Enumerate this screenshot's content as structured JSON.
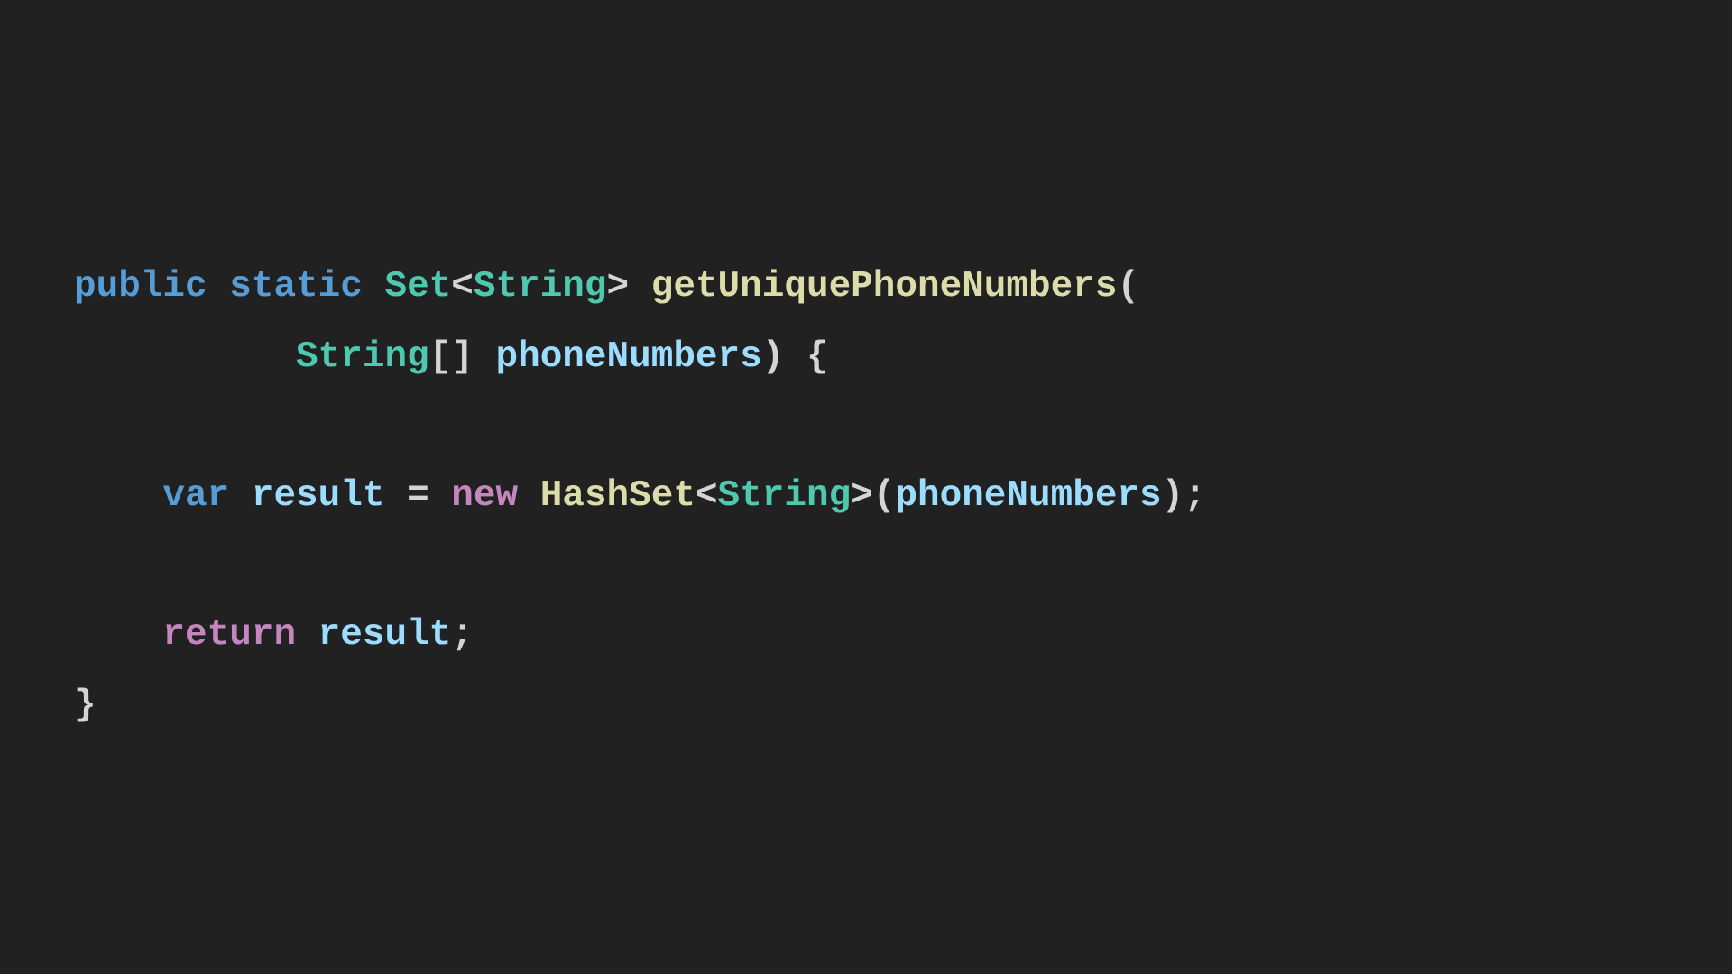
{
  "theme": {
    "background": "#212121",
    "keyword_color": "#569cd6",
    "control_color": "#c586c0",
    "type_color": "#4ec9b0",
    "function_color": "#dcdcaa",
    "variable_color": "#9cdcfe",
    "punctuation_color": "#d4d4d4"
  },
  "code": {
    "line1": {
      "public": "public",
      "sp1": " ",
      "static": "static",
      "sp2": " ",
      "set": "Set",
      "lt": "<",
      "string": "String",
      "gt": ">",
      "sp3": " ",
      "method": "getUniquePhoneNumbers",
      "paren": "("
    },
    "line2": {
      "indent": "          ",
      "string": "String",
      "brackets": "[]",
      "sp1": " ",
      "param": "phoneNumbers",
      "close": ")",
      "sp2": " ",
      "brace": "{"
    },
    "line3": {
      "indent": "    ",
      "var": "var",
      "sp1": " ",
      "result": "result",
      "eq": " = ",
      "new": "new",
      "sp2": " ",
      "hashset": "HashSet",
      "lt": "<",
      "string": "String",
      "gt": ">(",
      "arg": "phoneNumbers",
      "close": ");"
    },
    "line4": {
      "indent": "    ",
      "return": "return",
      "sp1": " ",
      "result": "result",
      "semi": ";"
    },
    "line5": {
      "brace": "}"
    }
  }
}
